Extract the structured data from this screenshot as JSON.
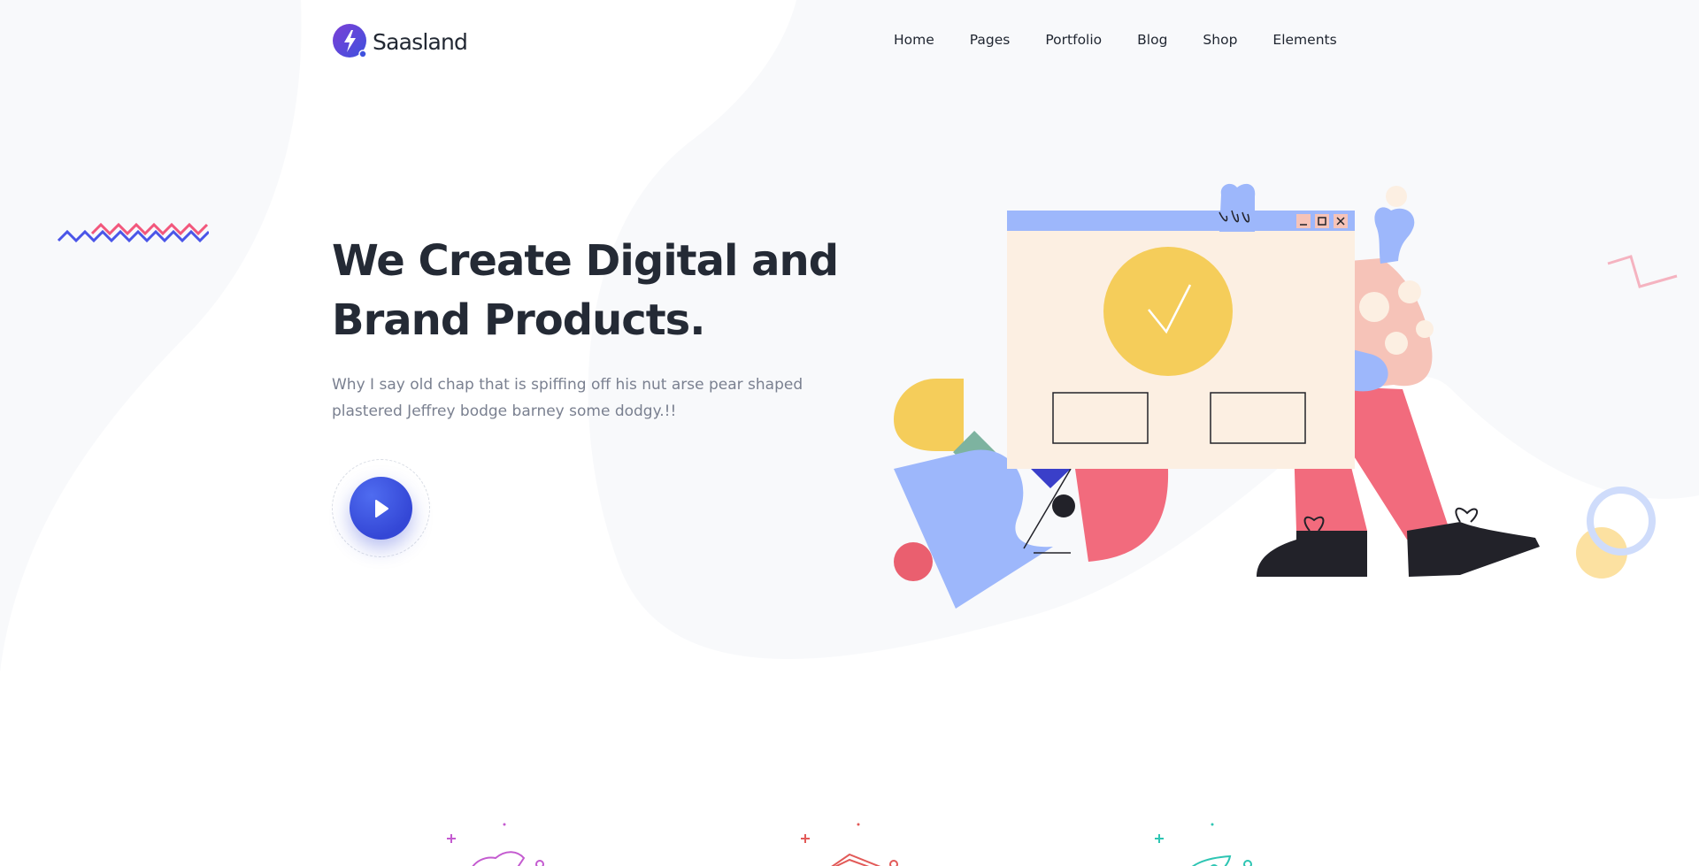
{
  "brand": {
    "name": "Saasland",
    "logo_icon": "lightning-bolt-icon",
    "accent": "#3f51de",
    "logo_gradient": [
      "#7b3fd6",
      "#3f51de"
    ]
  },
  "nav": {
    "items": [
      {
        "label": "Home"
      },
      {
        "label": "Pages"
      },
      {
        "label": "Portfolio"
      },
      {
        "label": "Blog"
      },
      {
        "label": "Shop"
      },
      {
        "label": "Elements"
      }
    ]
  },
  "hero": {
    "title_line1": "We Create Digital and",
    "title_line2": "Brand Products.",
    "description_line1": "Why I say old chap that is spiffing off his nut arse pear shaped",
    "description_line2": "plastered Jeffrey bodge barney some dodgy.!!",
    "play_icon": "play-icon"
  },
  "colors": {
    "title": "#242a35",
    "body_text": "#7a8090",
    "blob": "#f8f9fb",
    "yellow": "#f5cd5a",
    "pink": "#f26b7d",
    "lavender": "#9db7fb",
    "cream": "#fcefe2"
  },
  "features": {
    "icons": [
      "rocket-gear-icon",
      "cube-icon",
      "rocket-icon"
    ]
  }
}
